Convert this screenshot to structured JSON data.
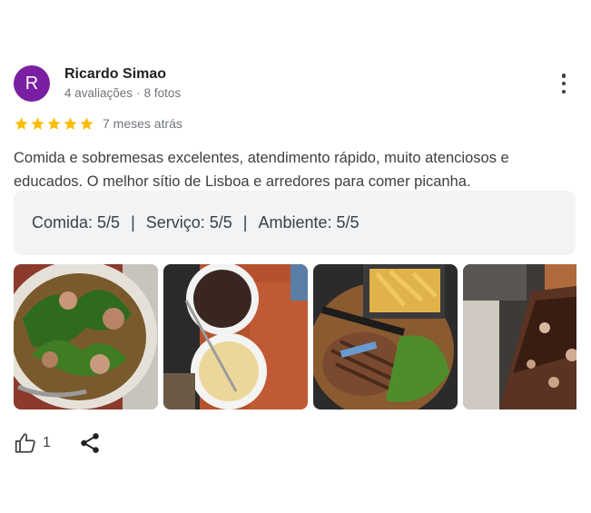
{
  "reviewer": {
    "initial": "R",
    "name": "Ricardo Simao",
    "reviews": "4 avaliações",
    "separator": "·",
    "photos": "8 fotos",
    "avatar_color": "#7b1fa2"
  },
  "rating": {
    "stars": 5,
    "max_stars": 5,
    "star_color": "#fbbc04",
    "time": "7 meses atrás"
  },
  "review_text": "Comida e sobremesas excelentes, atendimento rápido, muito atenciosos e educados. O melhor sítio de Lisboa e arredores para comer picanha.",
  "scores": {
    "food": "Comida: 5/5",
    "service": "Serviço: 5/5",
    "ambience": "Ambiente: 5/5",
    "divider": "|"
  },
  "photos": [
    {
      "subject": "stew-with-greens-photo"
    },
    {
      "subject": "beans-and-puree-photo"
    },
    {
      "subject": "picanha-and-fries-photo"
    },
    {
      "subject": "chocolate-cake-photo"
    }
  ],
  "actions": {
    "like_count": "1",
    "like_icon": "thumbs-up-icon",
    "share_icon": "share-icon"
  }
}
